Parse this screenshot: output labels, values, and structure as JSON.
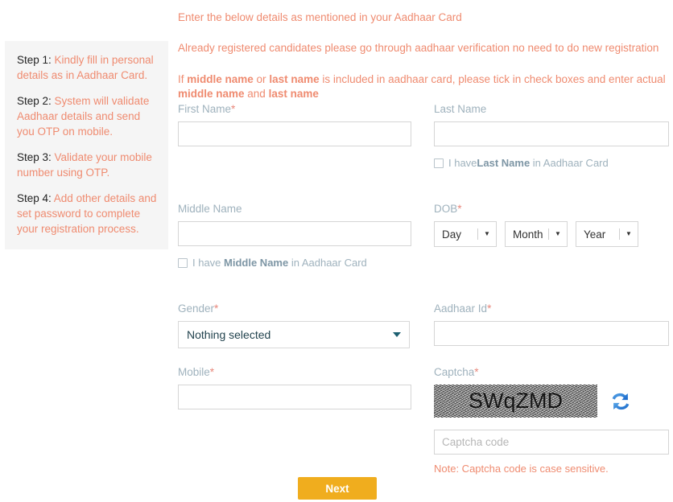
{
  "intro": {
    "line1": "Enter the below details as mentioned in your Aadhaar Card",
    "line2": "Already registered candidates please go through aadhaar verification no need to do new registration",
    "line3_a": "If ",
    "line3_b": "middle name",
    "line3_c": " or ",
    "line3_d": "last name",
    "line3_e": " is included in aadhaar card, please tick in check boxes and enter actual ",
    "line3_f": "middle name",
    "line3_g": " and ",
    "line3_h": "last name"
  },
  "sidebar": {
    "steps": [
      {
        "num": "Step 1: ",
        "text": "Kindly fill in personal details as in Aadhaar Card."
      },
      {
        "num": "Step 2: ",
        "text": "System will validate Aadhaar details and send you OTP on mobile."
      },
      {
        "num": "Step 3: ",
        "text": "Validate your mobile number using OTP."
      },
      {
        "num": "Step 4: ",
        "text": "Add other details and set password to complete your registration process."
      }
    ]
  },
  "form": {
    "first_name": {
      "label": "First Name",
      "required": "*",
      "value": "",
      "placeholder": ""
    },
    "last_name": {
      "label": "Last Name",
      "required": "",
      "value": "",
      "placeholder": "",
      "checkbox_a": "I have",
      "checkbox_b": "Last Name",
      "checkbox_c": " in Aadhaar Card",
      "checked": false
    },
    "middle_name": {
      "label": "Middle Name",
      "required": "",
      "value": "",
      "placeholder": "",
      "checkbox_a": "I have ",
      "checkbox_b": "Middle Name",
      "checkbox_c": " in Aadhaar Card",
      "checked": false
    },
    "dob": {
      "label": "DOB",
      "required": "*",
      "day": "Day",
      "month": "Month",
      "year": "Year",
      "caret": "▼"
    },
    "gender": {
      "label": "Gender",
      "required": "*",
      "selected": "Nothing selected"
    },
    "aadhaar_id": {
      "label": "Aadhaar Id",
      "required": "*",
      "value": "",
      "placeholder": ""
    },
    "mobile": {
      "label": "Mobile",
      "required": "*",
      "value": "",
      "placeholder": ""
    },
    "captcha": {
      "label": "Captcha",
      "required": "*",
      "image_text": "SWqZMD",
      "input_value": "",
      "input_placeholder": "Captcha code",
      "note": "Note: Captcha code is case sensitive."
    },
    "next_label": "Next"
  },
  "colors": {
    "accent_orange": "#ef8b70",
    "label_gray": "#9fb2bd",
    "required_red": "#e8877b",
    "button_amber": "#f0ad1e",
    "select_teal": "#1c5f70",
    "sidebar_bg": "#f5f5f5"
  }
}
